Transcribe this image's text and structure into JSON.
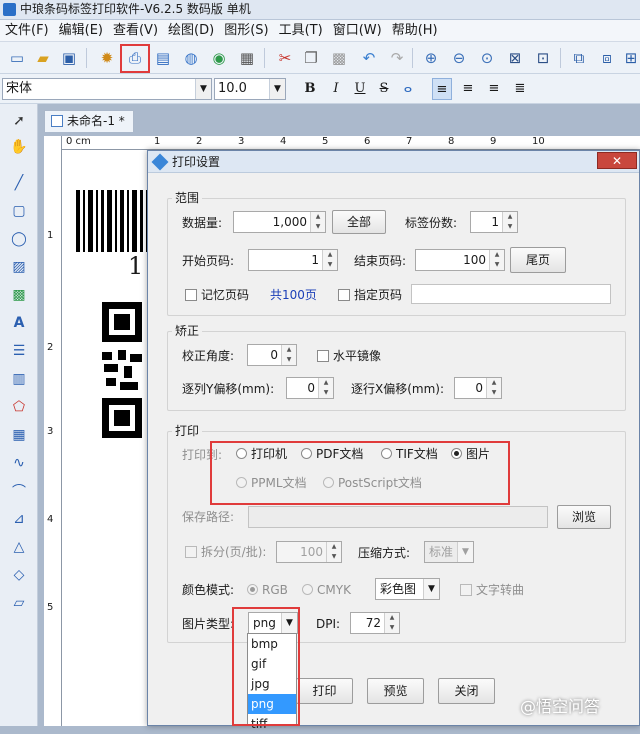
{
  "window": {
    "title": "中琅条码标签打印软件-V6.2.5 数码版 单机"
  },
  "menu": [
    "文件(F)",
    "编辑(E)",
    "查看(V)",
    "绘图(D)",
    "图形(S)",
    "工具(T)",
    "窗口(W)",
    "帮助(H)"
  ],
  "format": {
    "font": "宋体",
    "size": "10.0",
    "bold": "B",
    "italic": "I",
    "underline": "U",
    "strike": "S"
  },
  "document": {
    "tab": "未命名-1 *",
    "ruler_unit": "0 cm",
    "hticks": [
      "1",
      "2",
      "3",
      "4",
      "5",
      "6",
      "7",
      "8",
      "9",
      "10"
    ],
    "vticks": [
      "1",
      "2",
      "3",
      "4",
      "5"
    ]
  },
  "label": {
    "barcode_digit": "1"
  },
  "dialog": {
    "title": "打印设置",
    "close": "✕",
    "range": {
      "group": "范围",
      "qty_label": "数据量:",
      "qty_value": "1,000",
      "all_button": "全部",
      "copies_label": "标签份数:",
      "copies_value": "1",
      "start_label": "开始页码:",
      "start_value": "1",
      "end_label": "结束页码:",
      "end_value": "100",
      "last_button": "尾页",
      "remember_label": "记忆页码",
      "total_label": "共100页",
      "specify_label": "指定页码"
    },
    "correct": {
      "group": "矫正",
      "angle_label": "校正角度:",
      "angle_value": "0",
      "mirror_label": "水平镜像",
      "yoffset_label": "逐列Y偏移(mm):",
      "yoffset_value": "0",
      "xoffset_label": "逐行X偏移(mm):",
      "xoffset_value": "0"
    },
    "print": {
      "group": "打印",
      "to_label": "打印到:",
      "opt_printer": "打印机",
      "opt_pdf": "PDF文档",
      "opt_tif": "TIF文档",
      "opt_image": "图片",
      "opt_ppml": "PPML文档",
      "opt_ps": "PostScript文档",
      "path_label": "保存路径:",
      "browse_button": "浏览",
      "split_label": "拆分(页/批):",
      "split_value": "100",
      "compress_label": "压缩方式:",
      "compress_value": "标准",
      "color_label": "颜色模式:",
      "rgb_label": "RGB",
      "cmyk_label": "CMYK",
      "color_value": "彩色图",
      "text_curve_label": "文字转曲",
      "image_type_label": "图片类型:",
      "image_type_value": "png",
      "dpi_label": "DPI:",
      "dpi_value": "72",
      "image_type_options": [
        "bmp",
        "gif",
        "jpg",
        "png",
        "tiff"
      ]
    },
    "buttons": {
      "print": "打印",
      "preview": "预览",
      "close": "关闭"
    }
  },
  "watermark": "@悟空问答",
  "colors": {
    "highlight": "#e03b3b",
    "selection": "#3399ff"
  }
}
